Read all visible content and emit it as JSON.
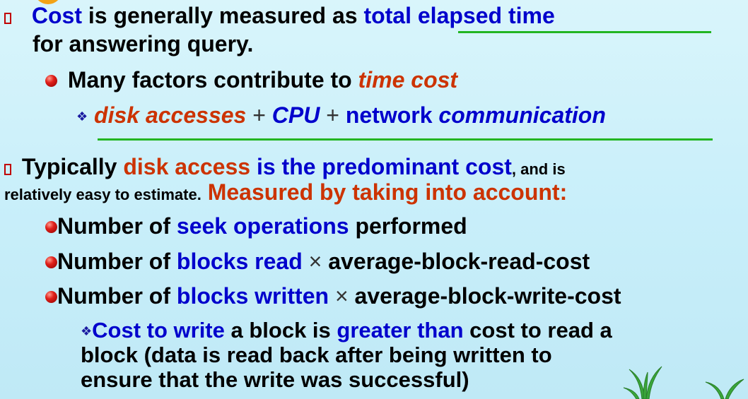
{
  "b1": {
    "bullet_icon": "box-bullet-icon",
    "word_cost": "Cost",
    "text_measured": " is generally measured as ",
    "link_total": "total elapsed time",
    "line2": "for answering query."
  },
  "b2": {
    "bullet_icon": "red-ball-icon",
    "text": "Many factors contribute to ",
    "emph": "time cost"
  },
  "b3": {
    "bullet_icon": "diamond-icon",
    "disk": "disk accesses",
    "plus": " + ",
    "cpu": "CPU",
    "network": " network ",
    "comm": "communication"
  },
  "b4": {
    "bullet_icon": "box-bullet-icon",
    "typically": "Typically ",
    "disk_access": "disk access",
    "predominant": " is the predominant cost",
    "tail_small": ", and is",
    "line2_small": "relatively easy to estimate.",
    "measured": " Measured by taking into account:"
  },
  "b5": {
    "bullet_icon": "red-ball-icon",
    "lead": "Number of ",
    "seek": "seek operations",
    "tail": " performed"
  },
  "b6": {
    "bullet_icon": "red-ball-icon",
    "lead": "Number of ",
    "blocks_read": "blocks read",
    "times": " × ",
    "tail": "average-block-read-cost"
  },
  "b7": {
    "bullet_icon": "red-ball-icon",
    "lead": "Number of ",
    "blocks_written": "blocks written",
    "times": " × ",
    "tail": "average-block-write-cost"
  },
  "b8": {
    "bullet_icon": "diamond-icon",
    "cost_write": "Cost to write",
    "mid": " a block is ",
    "greater": "greater than",
    "tail": " cost to read a",
    "line2": "block (data is read back after being written to",
    "line3": "ensure that the write was successful)"
  },
  "decor": {
    "corner_icon": "orange-corner-shape",
    "plant_icon": "green-plant-decoration"
  },
  "colors": {
    "blue": "#0000cc",
    "red": "#cc3300",
    "green_underline": "#22b522"
  }
}
